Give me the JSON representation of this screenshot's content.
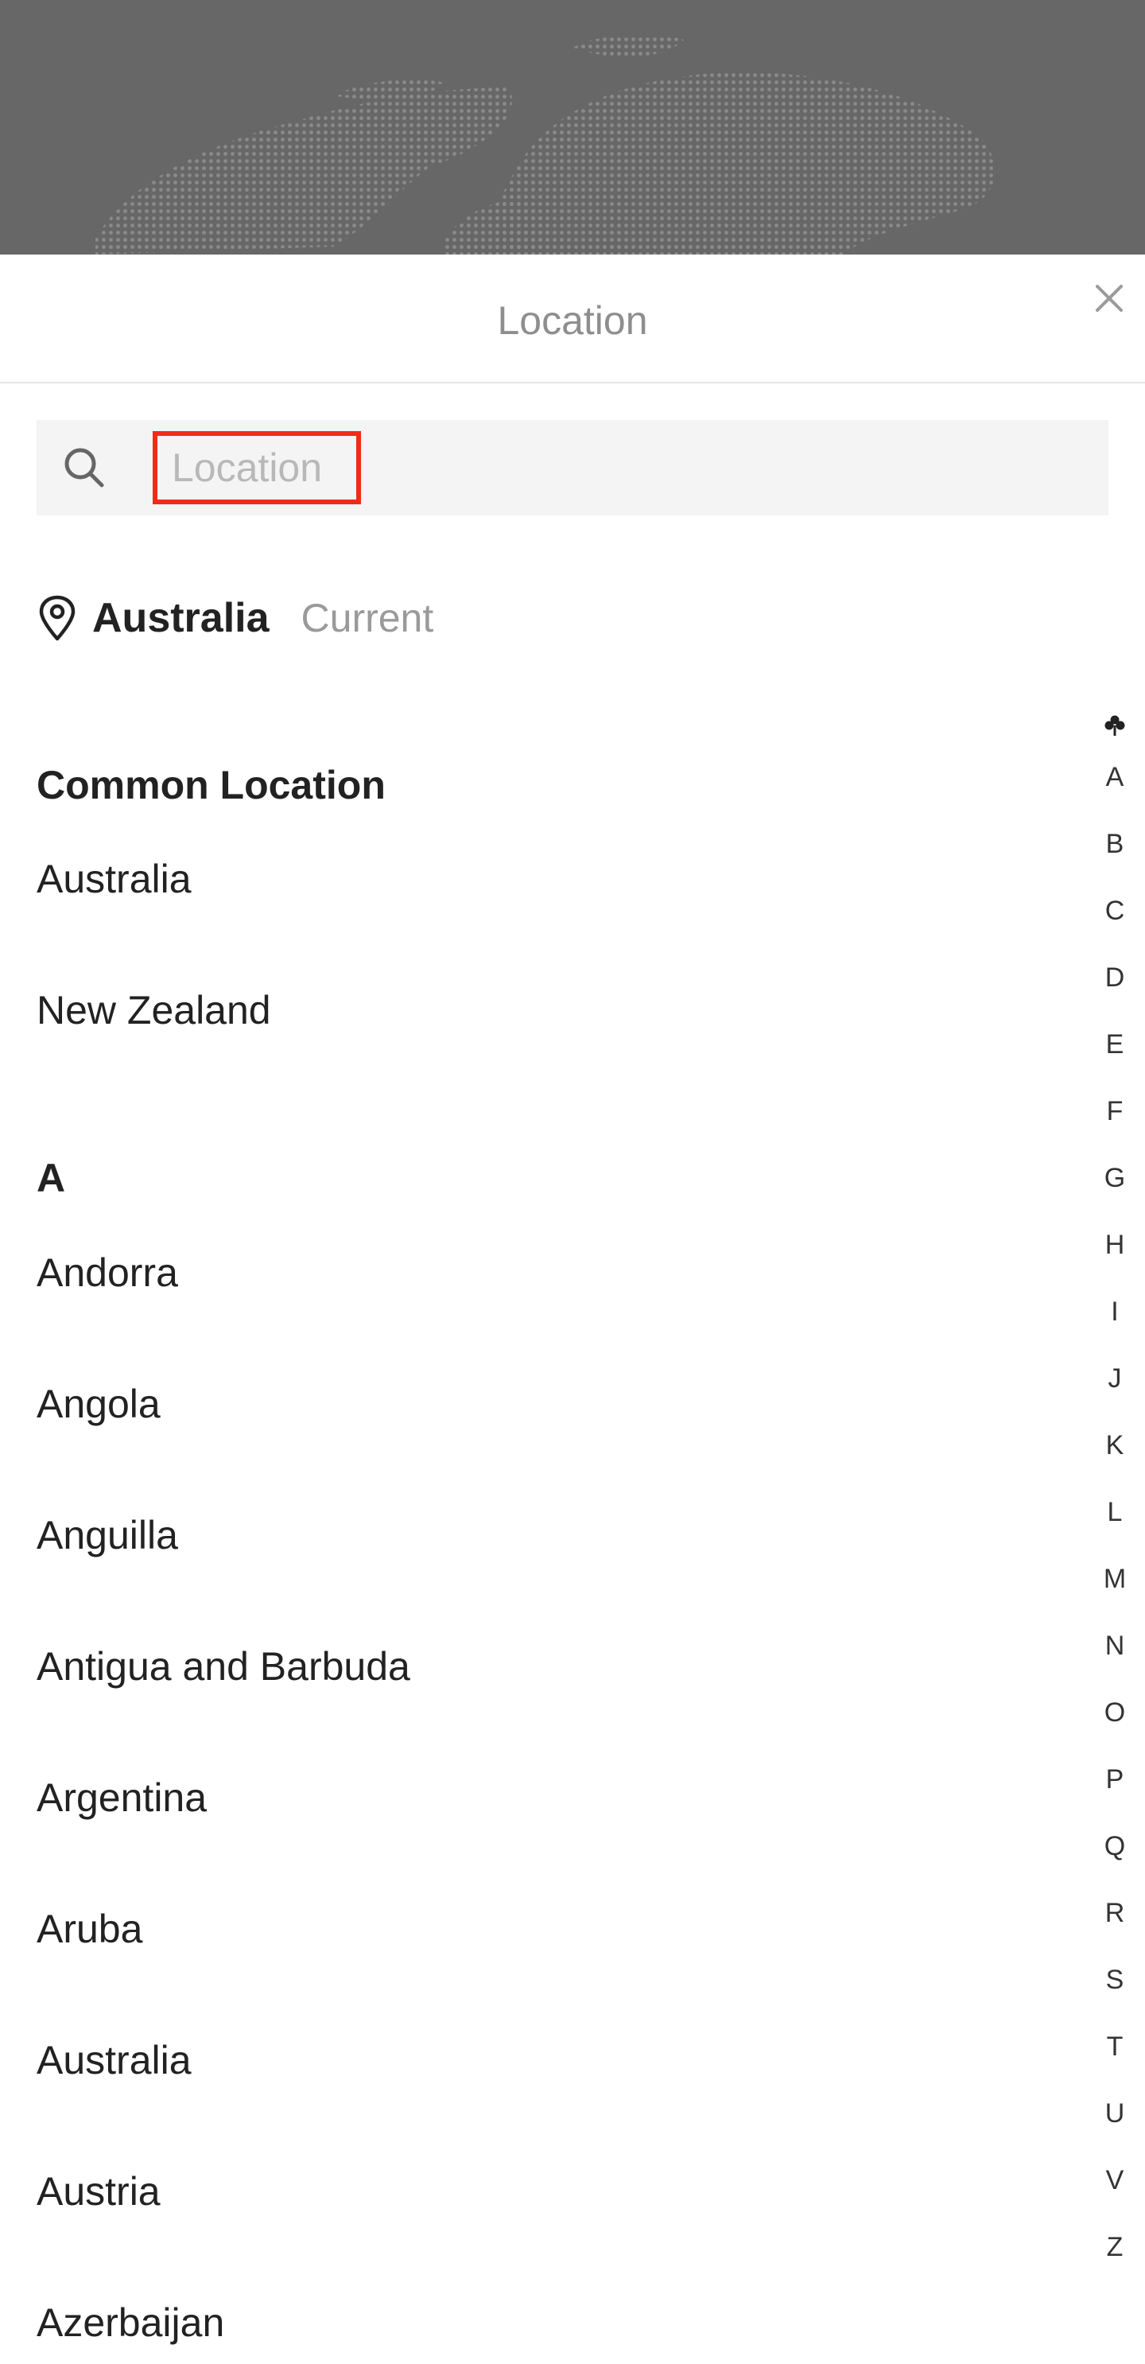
{
  "header": {
    "title": "Location",
    "close_icon": "close-icon"
  },
  "search": {
    "placeholder": "Location",
    "value": "",
    "icon": "search-icon"
  },
  "current_location": {
    "icon": "map-pin-icon",
    "name": "Australia",
    "tag": "Current"
  },
  "common": {
    "title": "Common Location",
    "items": [
      "Australia",
      "New Zealand"
    ]
  },
  "section_a": {
    "title": "A",
    "items": [
      "Andorra",
      "Angola",
      "Anguilla",
      "Antigua and Barbuda",
      "Argentina",
      "Aruba",
      "Australia",
      "Austria",
      "Azerbaijan"
    ]
  },
  "index": {
    "top_icon": "clover-icon",
    "letters": [
      "A",
      "B",
      "C",
      "D",
      "E",
      "F",
      "G",
      "H",
      "I",
      "J",
      "K",
      "L",
      "M",
      "N",
      "O",
      "P",
      "Q",
      "R",
      "S",
      "T",
      "U",
      "V",
      "Z"
    ]
  },
  "colors": {
    "backdrop": "#676767",
    "highlight": "#ef2d17",
    "muted_text": "#9a9a9a"
  }
}
